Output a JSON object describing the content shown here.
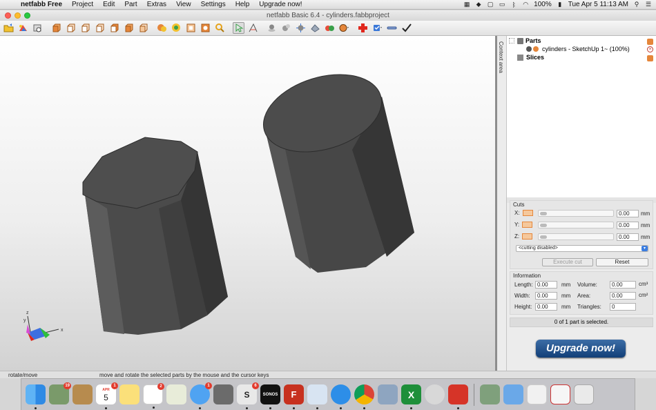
{
  "menubar": {
    "app_name": "netfabb Free",
    "items": [
      "Project",
      "Edit",
      "Part",
      "Extras",
      "View",
      "Settings",
      "Help",
      "Upgrade now!"
    ],
    "battery": "100%",
    "clock": "Tue Apr 5  11:13 AM"
  },
  "window": {
    "title": "netfabb Basic 6.4 - cylinders.fabbproject"
  },
  "side_tab": {
    "label": "Context area"
  },
  "tree": {
    "parts_label": "Parts",
    "part_item": "cylinders - SketchUp 1~ (100%)",
    "slices_label": "Slices"
  },
  "cuts": {
    "title": "Cuts",
    "rows": [
      {
        "axis": "X:",
        "value": "0.00",
        "unit": "mm"
      },
      {
        "axis": "Y:",
        "value": "0.00",
        "unit": "mm"
      },
      {
        "axis": "Z:",
        "value": "0.00",
        "unit": "mm"
      }
    ],
    "mode": "<cutting disabled>",
    "execute_label": "Execute cut",
    "reset_label": "Reset"
  },
  "information": {
    "title": "Information",
    "length_label": "Length:",
    "length_value": "0.00",
    "length_unit": "mm",
    "width_label": "Width:",
    "width_value": "0.00",
    "width_unit": "mm",
    "height_label": "Height:",
    "height_value": "0.00",
    "height_unit": "mm",
    "volume_label": "Volume:",
    "volume_value": "0.00",
    "volume_unit": "cm³",
    "area_label": "Area:",
    "area_value": "0.00",
    "area_unit": "cm²",
    "triangles_label": "Triangles:",
    "triangles_value": "0"
  },
  "selection_status": "0 of 1 part is selected.",
  "upgrade_button": "Upgrade now!",
  "statusbar": {
    "mode": "rotate/move",
    "hint": "move and rotate the selected parts by the mouse and the cursor keys"
  },
  "axis_labels": {
    "x": "x",
    "y": "y",
    "z": "z"
  },
  "dock": {
    "photos_badge": "19",
    "calendar_day": "5",
    "calendar_month": "APR",
    "calendar_badge": "1",
    "reminders_badge": "2",
    "messages_badge": "1",
    "slack_badge": "6",
    "sonos_label": "SONOS"
  },
  "colors": {
    "accent_orange": "#e5863a",
    "upgrade_blue": "#1d4f8c",
    "cylinder_gray": "#4a4a4a"
  }
}
